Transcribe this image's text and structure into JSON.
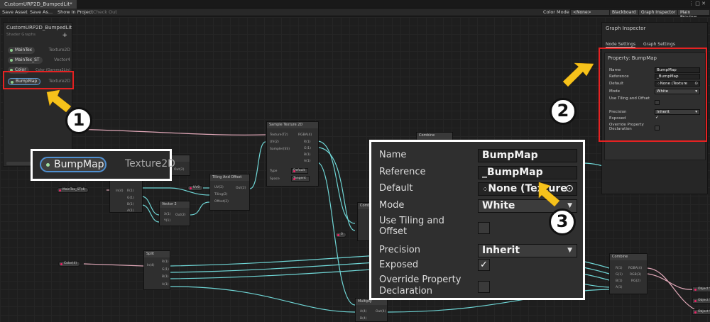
{
  "window": {
    "tab_title": "CustomURP2D_BumpedLit*",
    "controls": "⋮ □ ✕"
  },
  "toolbar": {
    "save_asset": "Save Asset",
    "save_as": "Save As...",
    "show_in_project": "Show In Project",
    "check_out": "Check Out",
    "color_mode_label": "Color Mode",
    "color_mode_value": "<None>",
    "blackboard": "Blackboard",
    "graph_inspector": "Graph Inspector",
    "main_preview": "Main Preview"
  },
  "blackboard": {
    "title": "CustomURP2D_BumpedLit",
    "subtitle": "Shader Graphs",
    "add": "+",
    "properties": [
      {
        "name": "MainTex",
        "type": "Texture2D"
      },
      {
        "name": "MainTex_ST",
        "type": "Vector4"
      },
      {
        "name": "Color",
        "type": "Color (Gamma2Lin)"
      },
      {
        "name": "BumpMap",
        "type": "Texture2D"
      }
    ]
  },
  "nodes": {
    "sample_texture": {
      "title": "Sample Texture 2D",
      "inputs": [
        "Texture(T2)",
        "UV(2)",
        "Sampler(SS)"
      ],
      "outputs": [
        "RGBA(4)",
        "R(1)",
        "G(1)",
        "B(1)",
        "A(1)"
      ],
      "type_label": "Type",
      "type_value": "Default",
      "space_label": "Space",
      "space_value": "Tangent"
    },
    "tiling": {
      "title": "Tiling And Offset",
      "inputs": [
        "UV(2)",
        "Tiling(2)",
        "Offset(2)"
      ],
      "output": "Out(2)",
      "uv_chip": "UV0"
    },
    "vector2": {
      "title": "Vector 2",
      "inputs": [
        "X(1)",
        "Y(1)"
      ],
      "output": "Out(2)"
    },
    "split": {
      "title": "Split",
      "input": "In(4)",
      "outputs": [
        "R(1)",
        "G(1)",
        "B(1)",
        "A(1)"
      ]
    },
    "split_top": {
      "input": "In(4)",
      "outputs": [
        "R(1)",
        "G(1)",
        "B(1)",
        "A(1)"
      ]
    },
    "multiply": {
      "title": "Multiply",
      "output": "Out(4)",
      "inputs": [
        "A(4)",
        "B(4)"
      ]
    },
    "combine_right": {
      "title": "Combine",
      "inputs": [
        "R(1)",
        "G(1)",
        "B(1)",
        "A(1)"
      ],
      "outputs": [
        "RGBA(4)",
        "RGB(3)",
        "RG(2)"
      ]
    },
    "combine_top": "Combine",
    "combine_mid": "Combi",
    "value_chip": "0",
    "maintex_st_chip": "MainTex_ST(4)",
    "color_chip": "Color(4)",
    "out_labels": [
      "Object Spa",
      "Object Spa",
      "Object Spa"
    ]
  },
  "inspector": {
    "title": "Graph Inspector",
    "tabs": [
      "Node Settings",
      "Graph Settings"
    ],
    "property_header": "Property: BumpMap",
    "rows": {
      "name_label": "Name",
      "name_value": "BumpMap",
      "reference_label": "Reference",
      "reference_value": "_BumpMap",
      "default_label": "Default",
      "default_value": "None (Texture",
      "mode_label": "Mode",
      "mode_value": "White",
      "tiling_label": "Use Tiling and Offset",
      "precision_label": "Precision",
      "precision_value": "Inherit",
      "exposed_label": "Exposed",
      "override_label": "Override Property Declaration"
    }
  },
  "zoom_blackboard": {
    "name": "BumpMap",
    "type": "Texture2D"
  },
  "zoom_inspector": {
    "name_label": "Name",
    "name_value": "BumpMap",
    "reference_label": "Reference",
    "reference_value": "_BumpMap",
    "default_label": "Default",
    "default_value": "None (Texture",
    "mode_label": "Mode",
    "mode_value": "White",
    "tiling_label_1": "Use Tiling and",
    "tiling_label_2": "Offset",
    "precision_label": "Precision",
    "precision_value": "Inherit",
    "exposed_label": "Exposed",
    "override_label_1": "Override Property",
    "override_label_2": "Declaration"
  },
  "callouts": [
    "1",
    "2",
    "3"
  ],
  "colors": {
    "highlight": "#e52222",
    "arrow": "#f6c21b",
    "wire_teal": "#6fd6d6",
    "wire_pink": "#e0a8b8"
  }
}
